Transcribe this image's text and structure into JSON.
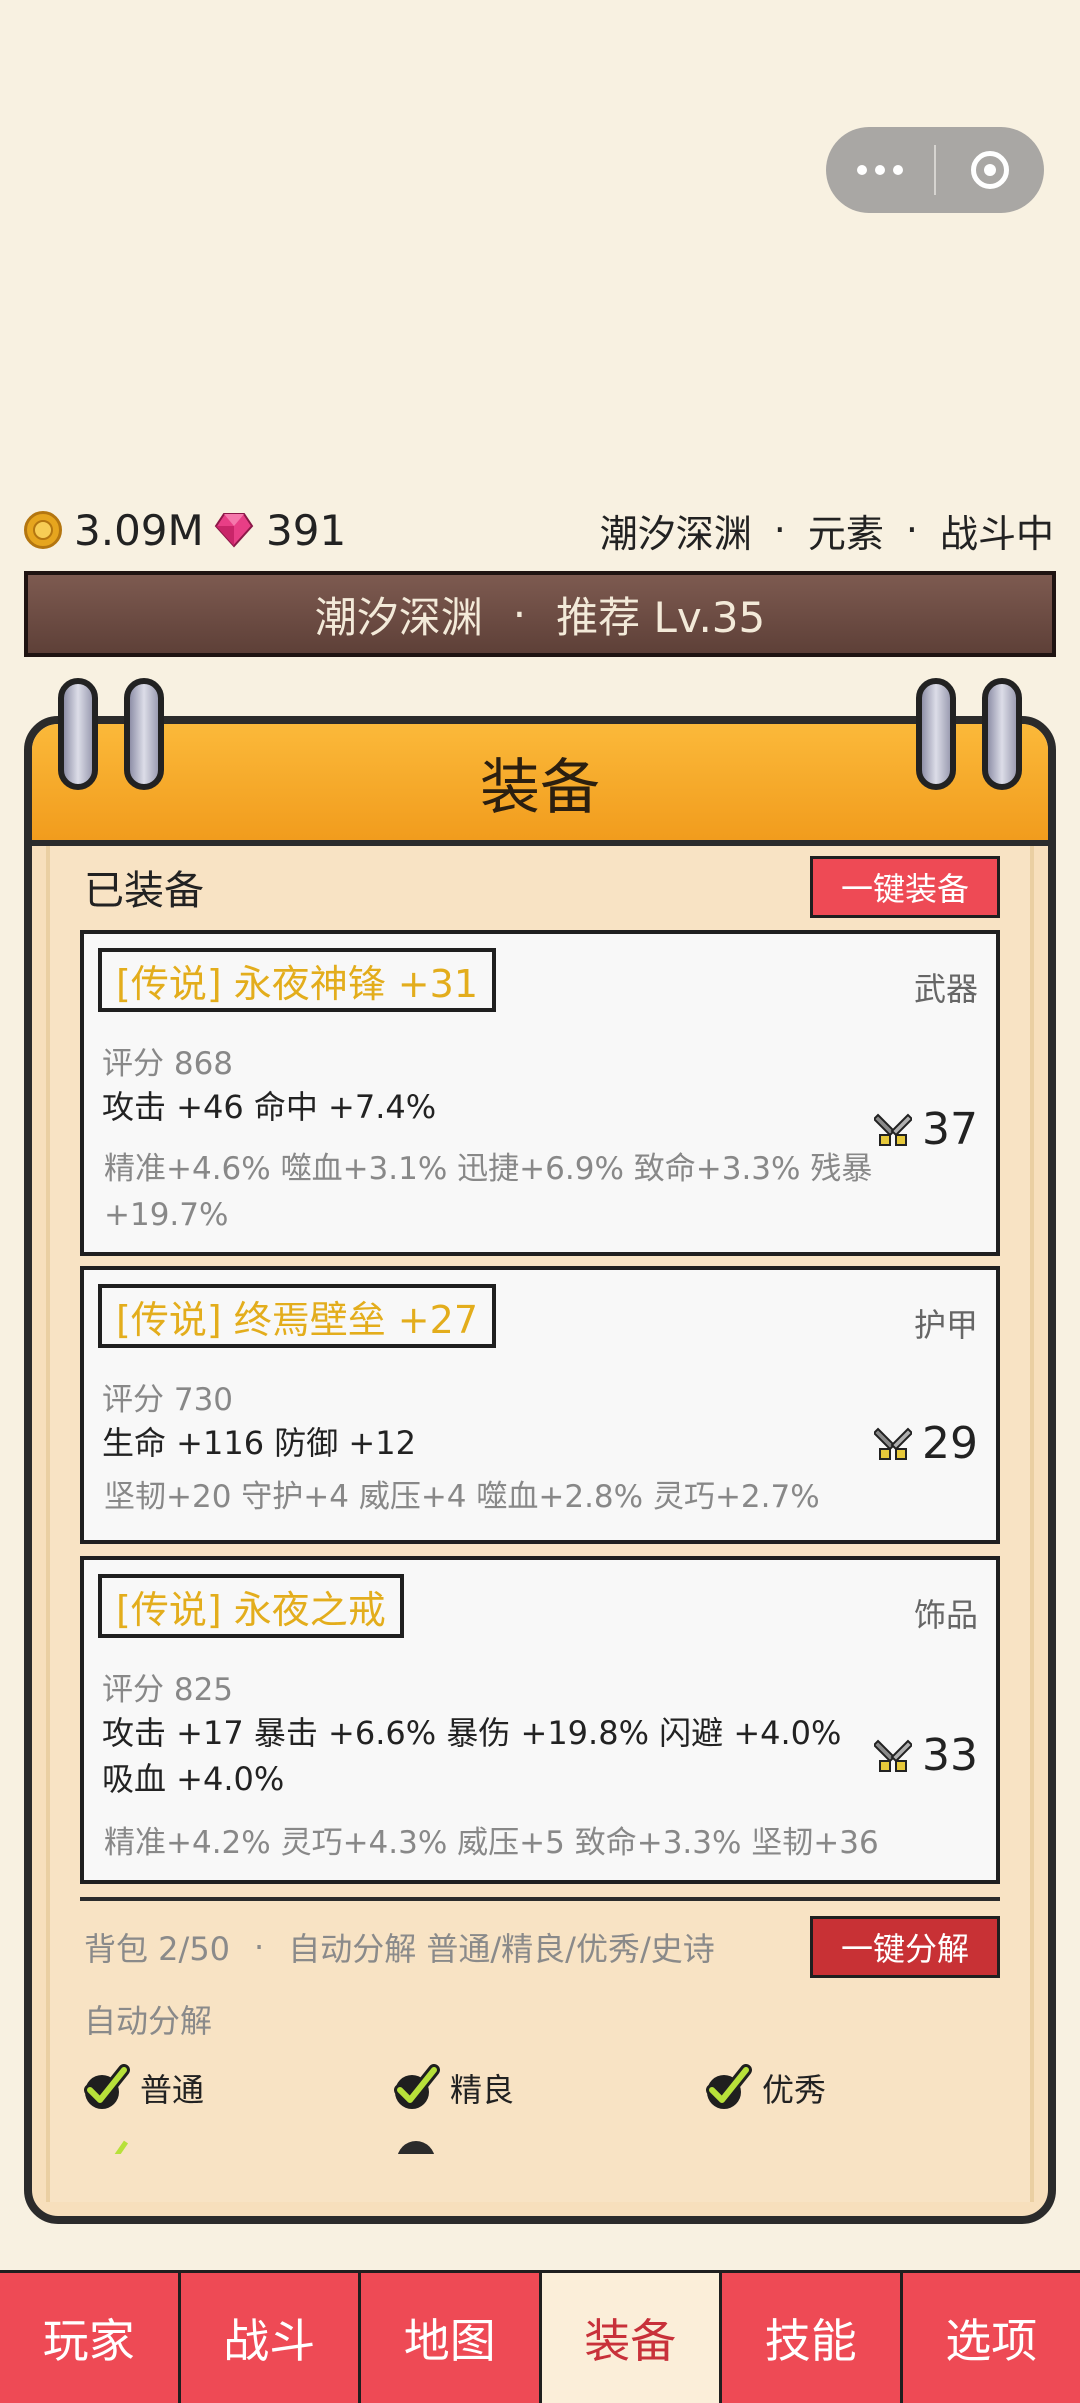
{
  "resources": {
    "gold": "3.09M",
    "gems": "391"
  },
  "status": {
    "area": "潮汐深渊",
    "element": "元素",
    "state": "战斗中"
  },
  "banner": {
    "area": "潮汐深渊",
    "recommend": "推荐 Lv.35"
  },
  "panel": {
    "title": "装备"
  },
  "equipped": {
    "title": "已装备",
    "equip_all_label": "一键装备",
    "items": [
      {
        "name": "[传说] 永夜神锋 +31",
        "slot": "武器",
        "score": "评分 868",
        "main": "攻击 +46  命中 +7.4%",
        "sub": "精准+4.6%  噬血+3.1%  迅捷+6.9%  致命+3.3%  残暴+19.7%",
        "power": "37"
      },
      {
        "name": "[传说] 终焉壁垒 +27",
        "slot": "护甲",
        "score": "评分 730",
        "main": "生命 +116  防御 +12",
        "sub": "坚韧+20  守护+4  威压+4  噬血+2.8%  灵巧+2.7%",
        "power": "29"
      },
      {
        "name": "[传说] 永夜之戒",
        "slot": "饰品",
        "score": "评分 825",
        "main": "攻击 +17  暴击 +6.6%  暴伤 +19.8%  闪避 +4.0%  吸血 +4.0%",
        "sub": "精准+4.2%  灵巧+4.3%  威压+5  致命+3.3%  坚韧+36",
        "power": "33"
      }
    ]
  },
  "bag": {
    "capacity": "背包 2/50",
    "auto_info": "自动分解 普通/精良/优秀/史诗",
    "decompose_all_label": "一键分解"
  },
  "auto_decompose": {
    "title": "自动分解",
    "options": [
      {
        "label": "普通",
        "checked": true
      },
      {
        "label": "精良",
        "checked": true
      },
      {
        "label": "优秀",
        "checked": true
      }
    ]
  },
  "nav": {
    "tabs": [
      "玩家",
      "战斗",
      "地图",
      "装备",
      "技能",
      "选项"
    ],
    "active": "装备"
  },
  "colors": {
    "accent_red": "#ee4a55",
    "legend_gold": "#e3ad1c",
    "panel_orange": "#f5a623",
    "check_green": "#b7e13a"
  }
}
